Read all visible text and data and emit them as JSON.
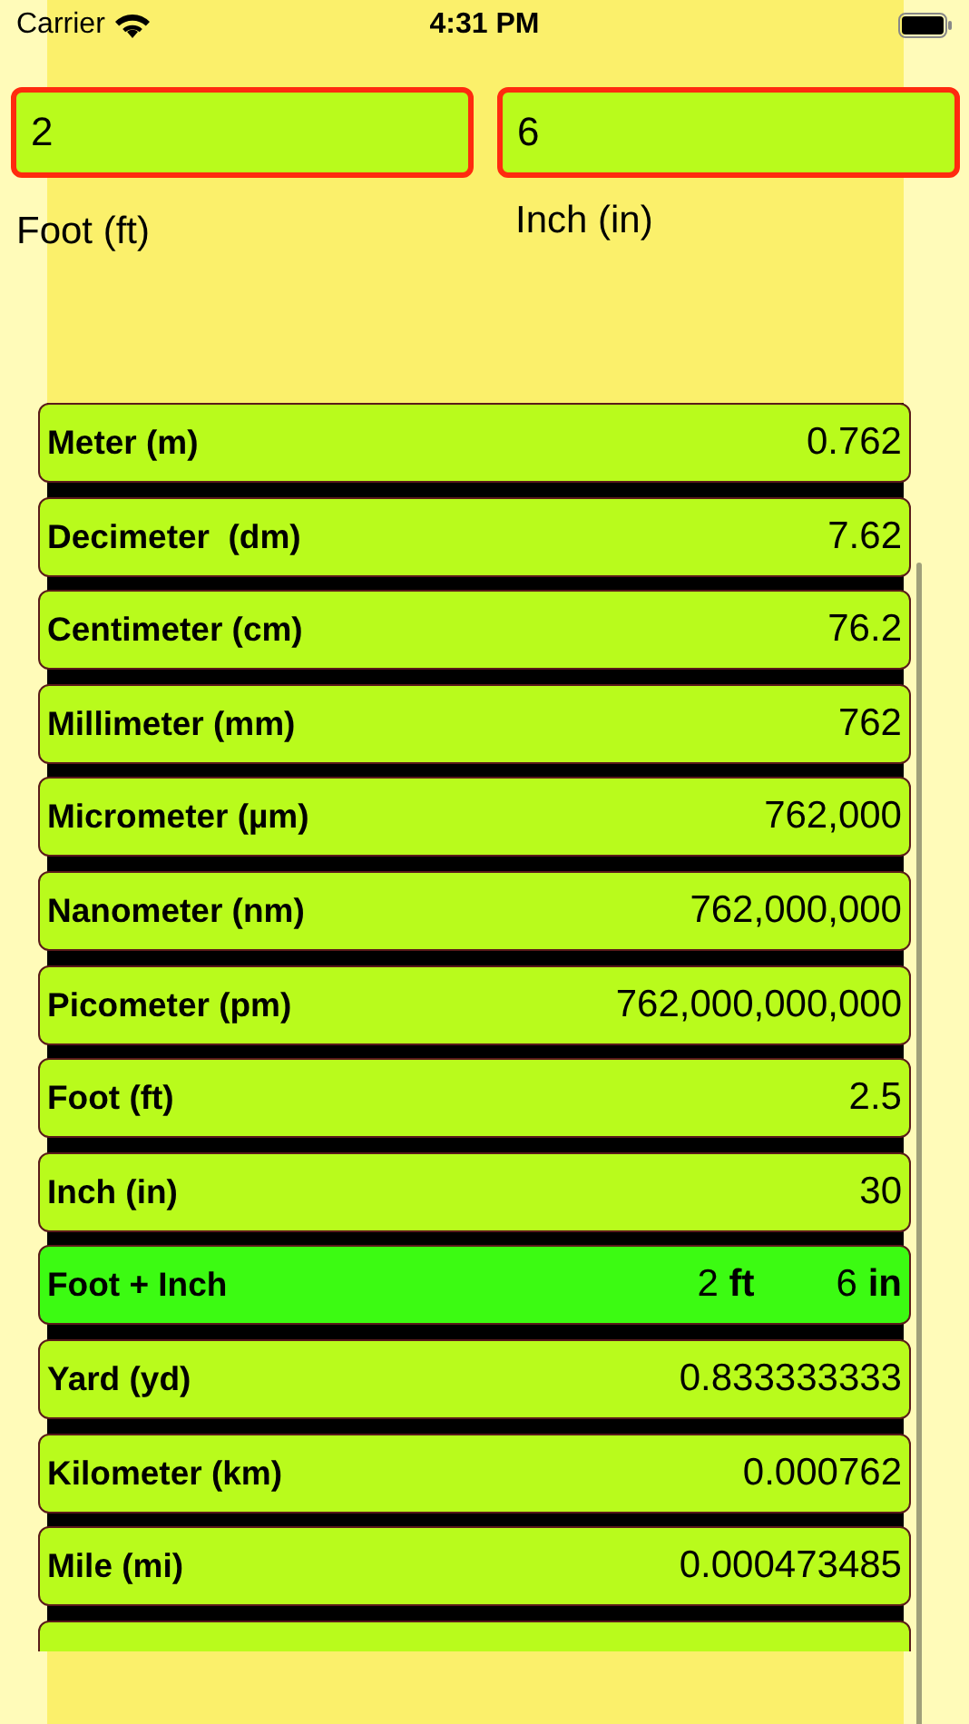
{
  "status_bar": {
    "carrier": "Carrier",
    "time": "4:31 PM"
  },
  "inputs": [
    {
      "value": "2",
      "label": "Foot (ft)"
    },
    {
      "value": "6",
      "label": "Inch (in)"
    }
  ],
  "results": [
    {
      "kind": "single",
      "label": "Meter (m)",
      "value": "0.762"
    },
    {
      "kind": "single",
      "label": "Decimeter  (dm)",
      "value": "7.62"
    },
    {
      "kind": "single",
      "label": "Centimeter (cm)",
      "value": "76.2"
    },
    {
      "kind": "single",
      "label": "Millimeter (mm)",
      "value": "762"
    },
    {
      "kind": "single",
      "label": "Micrometer (µm)",
      "value": "762,000"
    },
    {
      "kind": "single",
      "label": "Nanometer (nm)",
      "value": "762,000,000"
    },
    {
      "kind": "single",
      "label": "Picometer (pm)",
      "value": "762,000,000,000"
    },
    {
      "kind": "single",
      "label": "Foot (ft)",
      "value": "2.5"
    },
    {
      "kind": "single",
      "label": "Inch (in)",
      "value": "30"
    },
    {
      "kind": "combined",
      "label": "Foot + Inch",
      "parts": [
        {
          "value": "2",
          "unit": "ft"
        },
        {
          "value": "6",
          "unit": "in"
        }
      ]
    },
    {
      "kind": "single",
      "label": "Yard (yd)",
      "value": "0.833333333"
    },
    {
      "kind": "single",
      "label": "Kilometer (km)",
      "value": "0.000762"
    },
    {
      "kind": "single",
      "label": "Mile (mi)",
      "value": "0.000473485"
    },
    {
      "kind": "stub"
    }
  ]
}
